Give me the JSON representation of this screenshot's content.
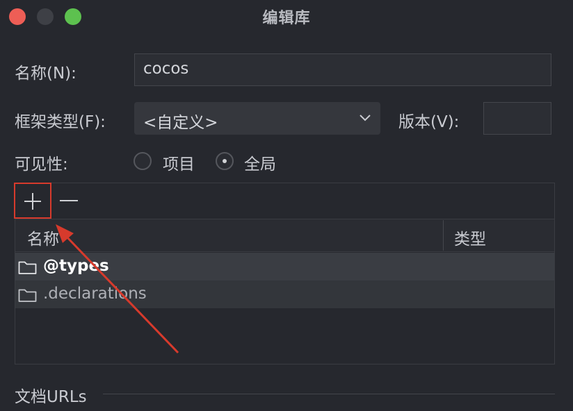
{
  "window": {
    "title": "编辑库"
  },
  "form": {
    "name_label": "名称(N):",
    "name_value": "cocos",
    "framework_label": "框架类型(F):",
    "framework_value": "<自定义>",
    "version_label": "版本(V):",
    "version_value": "",
    "visibility_label": "可见性:",
    "visibility_options": [
      "项目",
      "全局"
    ],
    "visibility_selected": "全局"
  },
  "toolbar": {
    "add_label": "+",
    "remove_label": "—"
  },
  "table": {
    "columns": [
      "名称",
      "类型"
    ],
    "rows": [
      {
        "name": "@types",
        "type": ""
      },
      {
        "name": ".declarations",
        "type": ""
      }
    ]
  },
  "docs": {
    "section_label": "文档URLs"
  },
  "annotation": {
    "highlight_color": "#d73a2c"
  }
}
